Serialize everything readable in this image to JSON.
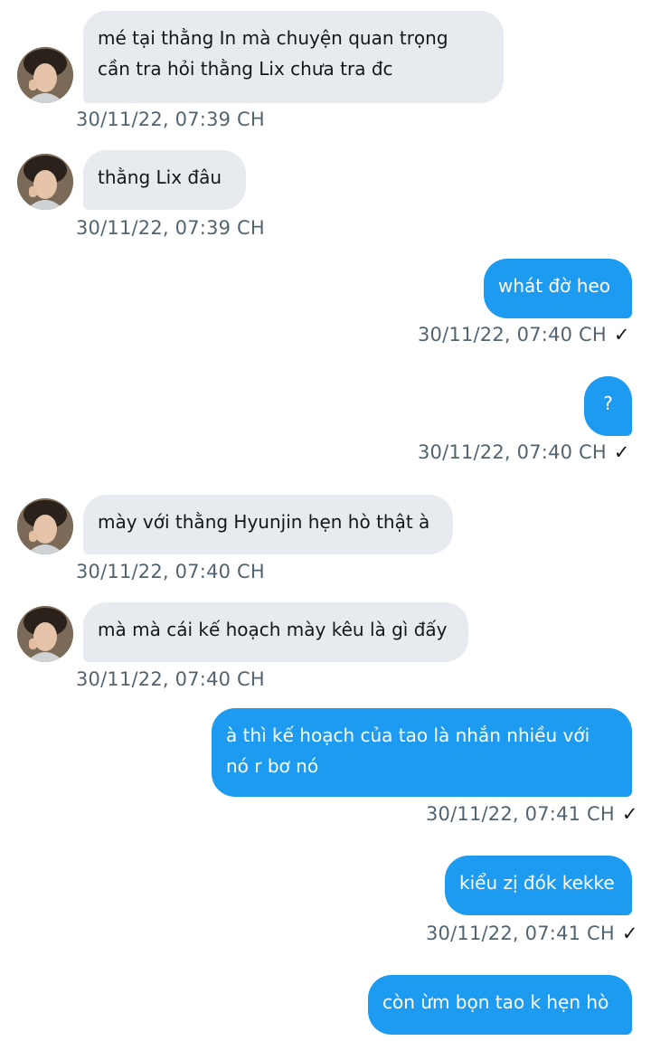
{
  "messages": [
    {
      "dir": "in",
      "text": "mé tại thằng In mà chuyện quan trọng\ncần tra hỏi thằng Lix chưa tra đc",
      "time": "30/11/22,  07:39 CH"
    },
    {
      "dir": "in",
      "text": "thằng Lix đâu",
      "time": "30/11/22,  07:39 CH"
    },
    {
      "dir": "out",
      "text": "whát đờ heo",
      "time": "30/11/22,  07:40 CH"
    },
    {
      "dir": "out",
      "text": "?",
      "time": "30/11/22,  07:40 CH"
    },
    {
      "dir": "in",
      "text": "mày với thằng Hyunjin hẹn hò thật à",
      "time": "30/11/22,  07:40 CH"
    },
    {
      "dir": "in",
      "text": "mà mà cái kế hoạch mày kêu là gì đấy",
      "time": "30/11/22,  07:40 CH"
    },
    {
      "dir": "out",
      "text": "à thì kế hoạch của tao là nhắn nhiều với\nnó r bơ nó",
      "time": "30/11/22,  07:41 CH"
    },
    {
      "dir": "out",
      "text": "kiểu zị đók kekke",
      "time": "30/11/22,  07:41 CH"
    },
    {
      "dir": "out",
      "text": "còn ừm bọn tao k hẹn hò",
      "time": ""
    }
  ],
  "icons": {
    "read_receipt": "check-icon",
    "avatar": "user-avatar"
  },
  "colors": {
    "incoming_bg": "#e7ebef",
    "outgoing_bg": "#1d9bf0",
    "timestamp": "#536471"
  }
}
